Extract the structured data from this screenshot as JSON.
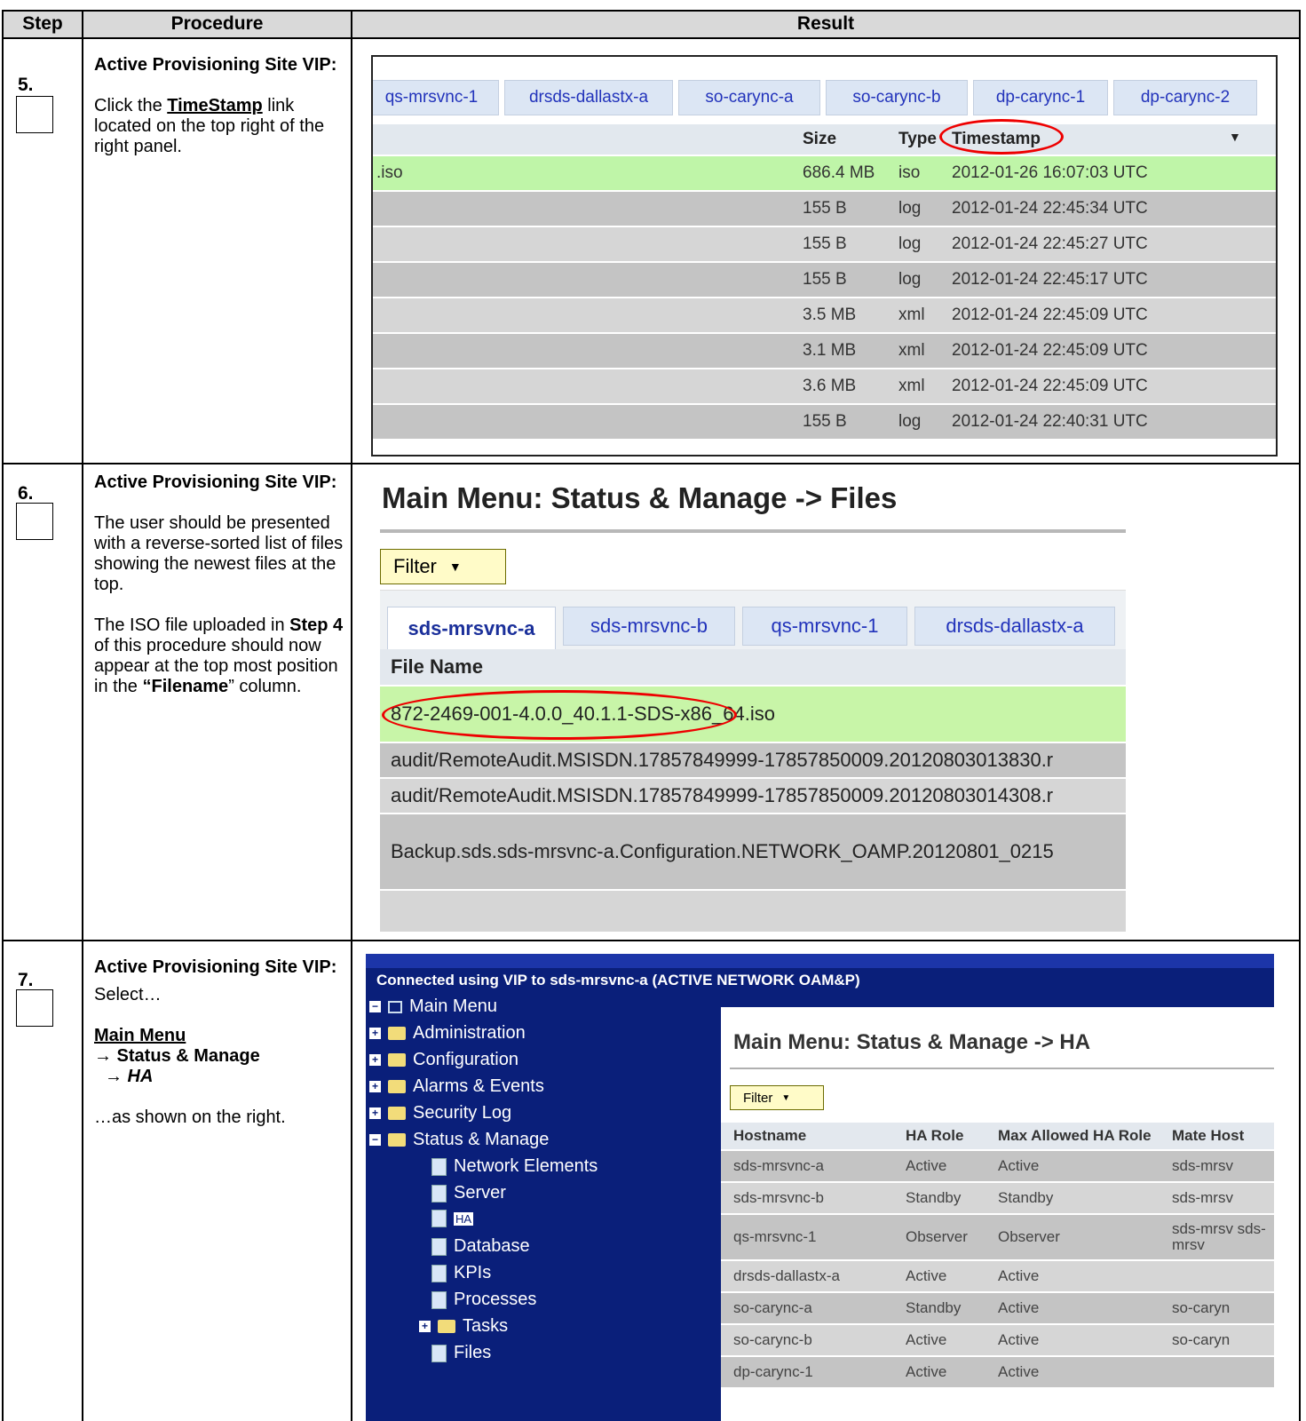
{
  "table": {
    "headers": {
      "step": "Step",
      "procedure": "Procedure",
      "result": "Result"
    },
    "rows": [
      {
        "num": "5.",
        "title": "Active Provisioning Site VIP:",
        "p1_pre": "Click the ",
        "p1_link": "TimeStamp",
        "p1_post": " link located on the top right of the right panel."
      },
      {
        "num": "6.",
        "title": "Active Provisioning Site VIP:",
        "p1": "The user should be presented with a reverse-sorted list of files showing the newest files at the top.",
        "p2_a": "The ISO file uploaded in ",
        "p2_b": "Step 4",
        "p2_c": " of this procedure should now appear at the top most position in the ",
        "p2_d": "“Filename",
        "p2_e": "” column."
      },
      {
        "num": "7.",
        "title": "Active Provisioning Site VIP:",
        "p1": "Select…",
        "menu1": "Main Menu",
        "menu2": "→ Status & Manage",
        "menu3": "→ HA",
        "p2": "…as shown on the right."
      }
    ]
  },
  "shot1": {
    "tabs": [
      "qs-mrsvnc-1",
      "drsds-dallastx-a",
      "so-carync-a",
      "so-carync-b",
      "dp-carync-1",
      "dp-carync-2"
    ],
    "columns": {
      "size": "Size",
      "type": "Type",
      "timestamp": "Timestamp"
    },
    "first_name": ".iso",
    "rows": [
      {
        "size": "686.4 MB",
        "type": "iso",
        "ts": "2012-01-26 16:07:03 UTC"
      },
      {
        "size": "155 B",
        "type": "log",
        "ts": "2012-01-24 22:45:34 UTC"
      },
      {
        "size": "155 B",
        "type": "log",
        "ts": "2012-01-24 22:45:27 UTC"
      },
      {
        "size": "155 B",
        "type": "log",
        "ts": "2012-01-24 22:45:17 UTC"
      },
      {
        "size": "3.5 MB",
        "type": "xml",
        "ts": "2012-01-24 22:45:09 UTC"
      },
      {
        "size": "3.1 MB",
        "type": "xml",
        "ts": "2012-01-24 22:45:09 UTC"
      },
      {
        "size": "3.6 MB",
        "type": "xml",
        "ts": "2012-01-24 22:45:09 UTC"
      },
      {
        "size": "155 B",
        "type": "log",
        "ts": "2012-01-24 22:40:31 UTC"
      }
    ]
  },
  "shot2": {
    "title": "Main Menu: Status & Manage -> Files",
    "filter": "Filter",
    "tabs": [
      "sds-mrsvnc-a",
      "sds-mrsvnc-b",
      "qs-mrsvnc-1",
      "drsds-dallastx-a"
    ],
    "column": "File Name",
    "files": [
      "872-2469-001-4.0.0_40.1.1-SDS-x86_64.iso",
      "audit/RemoteAudit.MSISDN.17857849999-17857850009.20120803013830.r",
      "audit/RemoteAudit.MSISDN.17857849999-17857850009.20120803014308.r",
      "Backup.sds.sds-mrsvnc-a.Configuration.NETWORK_OAMP.20120801_0215"
    ]
  },
  "shot3": {
    "banner": "Connected using VIP to sds-mrsvnc-a (ACTIVE NETWORK OAM&P)",
    "tree": {
      "root": "Main Menu",
      "items": [
        "Administration",
        "Configuration",
        "Alarms & Events",
        "Security Log",
        "Status & Manage"
      ],
      "sub": [
        "Network Elements",
        "Server",
        "HA",
        "Database",
        "KPIs",
        "Processes",
        "Tasks",
        "Files"
      ]
    },
    "title": "Main Menu: Status & Manage -> HA",
    "filter": "Filter",
    "columns": [
      "Hostname",
      "HA Role",
      "Max Allowed HA Role",
      "Mate Host"
    ],
    "rows": [
      [
        "sds-mrsvnc-a",
        "Active",
        "Active",
        "sds-mrsv"
      ],
      [
        "sds-mrsvnc-b",
        "Standby",
        "Standby",
        "sds-mrsv"
      ],
      [
        "qs-mrsvnc-1",
        "Observer",
        "Observer",
        "sds-mrsv sds-mrsv"
      ],
      [
        "drsds-dallastx-a",
        "Active",
        "Active",
        ""
      ],
      [
        "so-carync-a",
        "Standby",
        "Active",
        "so-caryn"
      ],
      [
        "so-carync-b",
        "Active",
        "Active",
        "so-caryn"
      ],
      [
        "dp-carync-1",
        "Active",
        "Active",
        ""
      ]
    ]
  }
}
